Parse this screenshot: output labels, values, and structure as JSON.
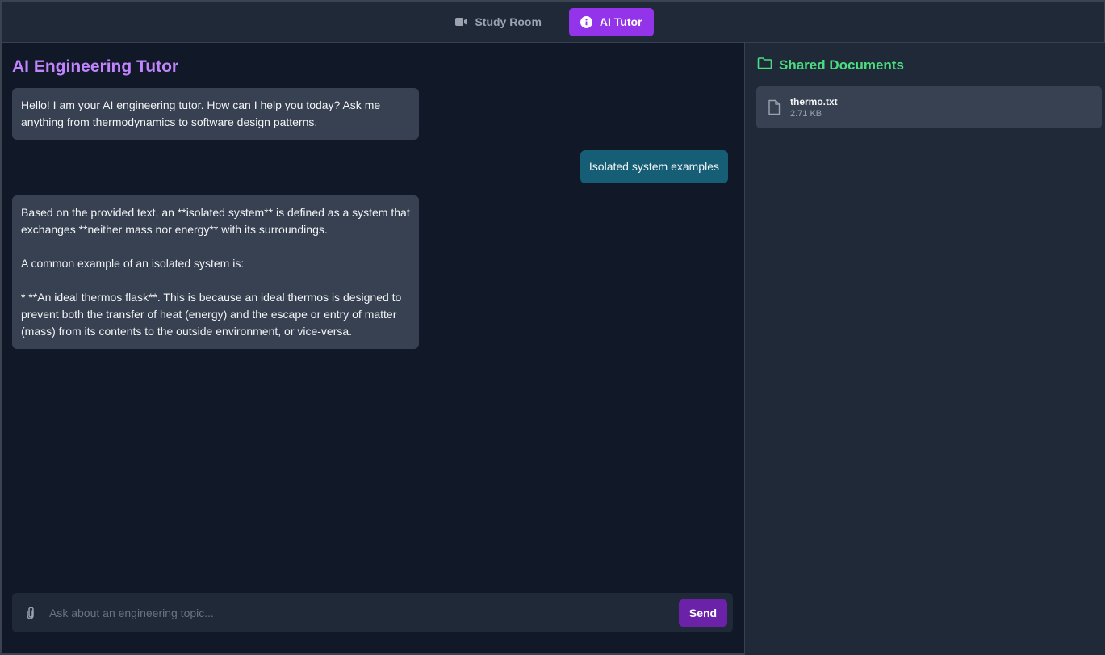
{
  "nav": {
    "tabs": [
      {
        "label": "Study Room",
        "icon": "video-icon",
        "active": false
      },
      {
        "label": "AI Tutor",
        "icon": "info-icon",
        "active": true
      }
    ]
  },
  "chat": {
    "title": "AI Engineering Tutor",
    "messages": [
      {
        "role": "bot",
        "text": "Hello! I am your AI engineering tutor. How can I help you today? Ask me anything from thermodynamics to software design patterns."
      },
      {
        "role": "user",
        "text": "Isolated system examples"
      },
      {
        "role": "bot",
        "text": "Based on the provided text, an **isolated system** is defined as a system that exchanges **neither mass nor energy** with its surroundings.\n\nA common example of an isolated system is:\n\n* **An ideal thermos flask**. This is because an ideal thermos is designed to prevent both the transfer of heat (energy) and the escape or entry of matter (mass) from its contents to the outside environment, or vice-versa."
      }
    ],
    "input": {
      "value": "",
      "placeholder": "Ask about an engineering topic..."
    },
    "send_label": "Send"
  },
  "docs": {
    "title": "Shared Documents",
    "files": [
      {
        "name": "thermo.txt",
        "size": "2.71 KB"
      }
    ]
  },
  "colors": {
    "accent": "#9333ea",
    "title_purple": "#c084fc",
    "docs_green": "#4ade80",
    "user_bubble": "#155e75",
    "bot_bubble": "#374151"
  }
}
